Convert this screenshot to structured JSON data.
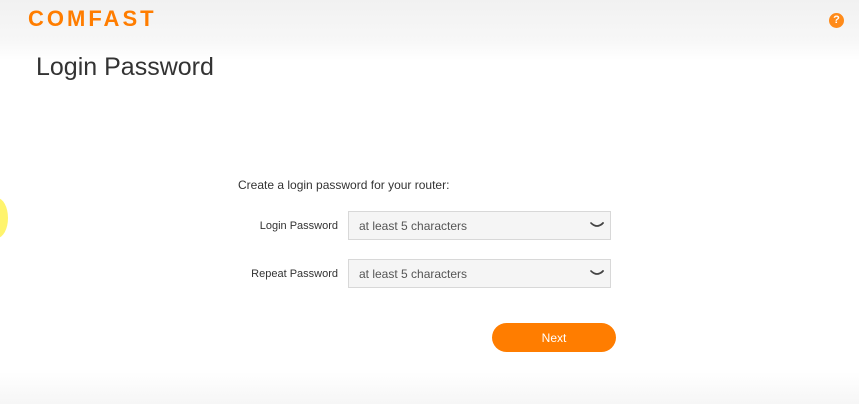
{
  "header": {
    "brand": "COMFAST",
    "brand_color": "#ff7d00",
    "help_icon": "question-circle-icon",
    "help_symbol": "?"
  },
  "page": {
    "title": "Login Password",
    "intro": "Create a login password for your router:"
  },
  "form": {
    "login_password": {
      "label": "Login Password",
      "placeholder": "at least 5 characters",
      "value": "",
      "toggle_icon": "closed-eye-icon"
    },
    "repeat_password": {
      "label": "Repeat Password",
      "placeholder": "at least 5 characters",
      "value": "",
      "toggle_icon": "closed-eye-icon"
    }
  },
  "actions": {
    "next_label": "Next"
  },
  "colors": {
    "accent": "#ff7d00",
    "field_background": "#f5f5f5",
    "field_border": "#d8d8d8",
    "text": "#333333"
  }
}
